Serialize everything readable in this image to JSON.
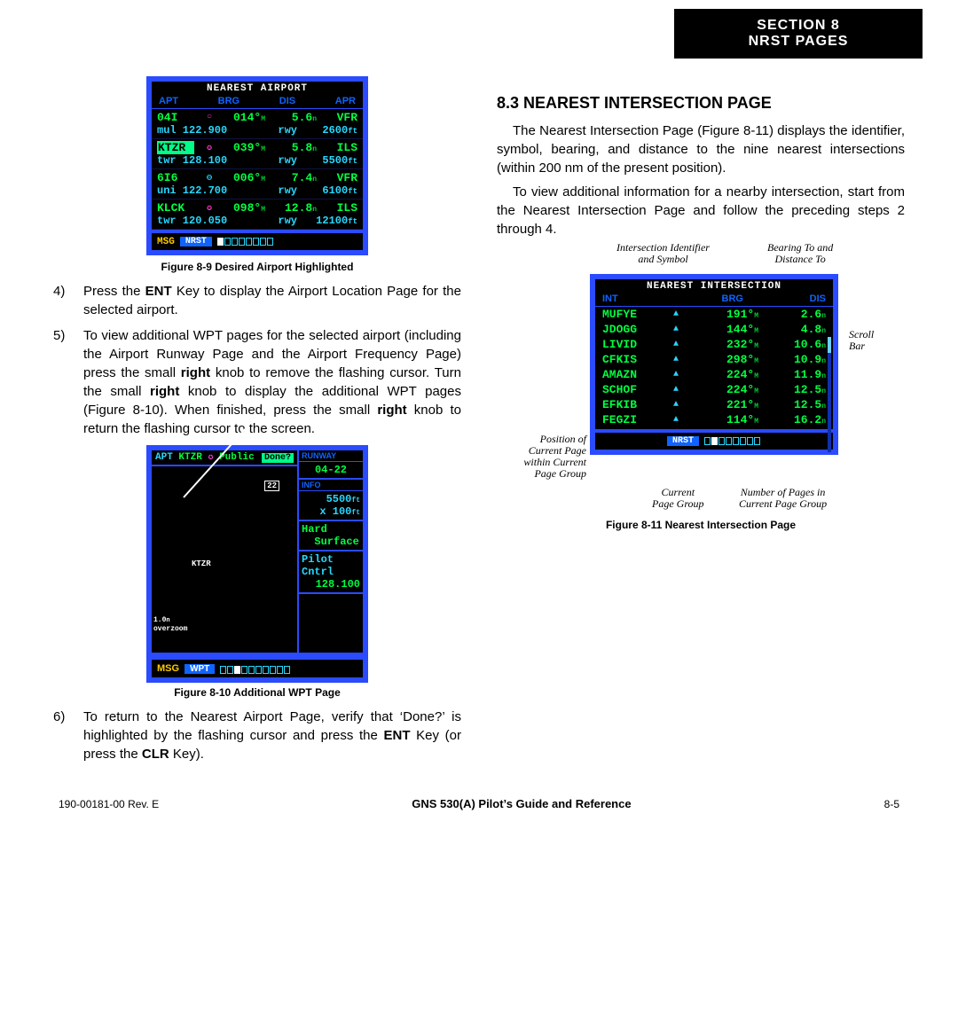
{
  "header": {
    "l1": "SECTION 8",
    "l2": "NRST PAGES"
  },
  "fig89": {
    "title": "NEAREST AIRPORT",
    "cols": [
      "APT",
      "BRG",
      "DIS",
      "APR"
    ],
    "rows": [
      {
        "id": "04I",
        "sym": "○",
        "brg": "014°",
        "dis": "5.6",
        "apr": "VFR",
        "freqlbl": "mul",
        "freq": "122.900",
        "rwy": "rwy",
        "len": "2600"
      },
      {
        "id": "KTZR",
        "hl": true,
        "sym": "✪",
        "brg": "039°",
        "dis": "5.8",
        "apr": "ILS",
        "freqlbl": "twr",
        "freq": "128.100",
        "rwy": "rwy",
        "len": "5500"
      },
      {
        "id": "6I6",
        "sym": "⊖",
        "brg": "006°",
        "dis": "7.4",
        "apr": "VFR",
        "freqlbl": "uni",
        "freq": "122.700",
        "rwy": "rwy",
        "len": "6100"
      },
      {
        "id": "KLCK",
        "sym": "✪",
        "brg": "098°",
        "dis": "12.8",
        "apr": "ILS",
        "freqlbl": "twr",
        "freq": "120.050",
        "rwy": "rwy",
        "len": "12100"
      }
    ],
    "msg": "MSG",
    "group": "NRST",
    "caption": "Figure 8-9  Desired Airport Highlighted"
  },
  "steps_left": [
    {
      "n": "4)",
      "html": "Press the <b>ENT</b> Key to display the Airport Location Page for the selected airport."
    },
    {
      "n": "5)",
      "html": "To view additional WPT pages for the selected airport (including the Airport Runway Page and the Airport Frequency Page) press the small <b>right</b> knob to remove the flashing cursor.  Turn the small <b>right</b> knob to display the additional WPT pages (Figure 8-10).  When finished, press the small <b>right</b> knob to return the flashing cursor to the screen."
    },
    {
      "n": "6)",
      "html": "To return to the Nearest Airport Page, verify that ‘Done?’ is highlighted by the flashing cursor and press the <b>ENT</b> Key (or press the <b>CLR</b> Key)."
    }
  ],
  "fig810": {
    "toplabel": "APT",
    "ident": "KTZR",
    "pub": "Public",
    "done": "Done?",
    "side": {
      "rwylab": "RUNWAY",
      "rwy": "04-22",
      "infolab": "INFO",
      "len": "5500",
      "wid": "x 100",
      "surf1": "Hard",
      "surf2": "Surface",
      "pc": "Pilot Cntrl",
      "freq": "128.100"
    },
    "rwynum": "22",
    "mapid": "KTZR",
    "zoom1": "1.0",
    "zoom2": "overzoom",
    "msg": "MSG",
    "group": "WPT",
    "caption": "Figure 8-10  Additional WPT Page"
  },
  "section83": {
    "title": "8.3  NEAREST INTERSECTION PAGE",
    "p1": "The Nearest Intersection Page (Figure 8-11) displays the identifier, symbol, bearing, and distance to the nine nearest intersections (within 200 nm of the present position).",
    "p2": "To view additional information for a nearby intersection, start from the Nearest Intersection Page and follow the preceding steps 2 through 4."
  },
  "fig811": {
    "title": "NEAREST INTERSECTION",
    "cols": [
      "INT",
      "BRG",
      "DIS"
    ],
    "rows": [
      {
        "id": "MUFYE",
        "brg": "191°",
        "dis": "2.6"
      },
      {
        "id": "JDOGG",
        "brg": "144°",
        "dis": "4.8"
      },
      {
        "id": "LIVID",
        "brg": "232°",
        "dis": "10.6"
      },
      {
        "id": "CFKIS",
        "brg": "298°",
        "dis": "10.9"
      },
      {
        "id": "AMAZN",
        "brg": "224°",
        "dis": "11.9"
      },
      {
        "id": "SCHOF",
        "brg": "224°",
        "dis": "12.5"
      },
      {
        "id": "EFKIB",
        "brg": "221°",
        "dis": "12.5"
      },
      {
        "id": "FEGZI",
        "brg": "114°",
        "dis": "16.2"
      }
    ],
    "group": "NRST",
    "caption": "Figure 8-11  Nearest Intersection Page",
    "annot": {
      "a1": "Intersection Identifier\nand Symbol",
      "a2": "Bearing To and\nDistance To",
      "a3": "Scroll\nBar",
      "a4": "Position of\nCurrent Page\nwithin Current\nPage Group",
      "a5": "Current\nPage Group",
      "a6": "Number of Pages in\nCurrent Page Group"
    }
  },
  "footer": {
    "left": "190-00181-00  Rev. E",
    "center": "GNS 530(A) Pilot’s Guide and Reference",
    "right": "8-5"
  }
}
